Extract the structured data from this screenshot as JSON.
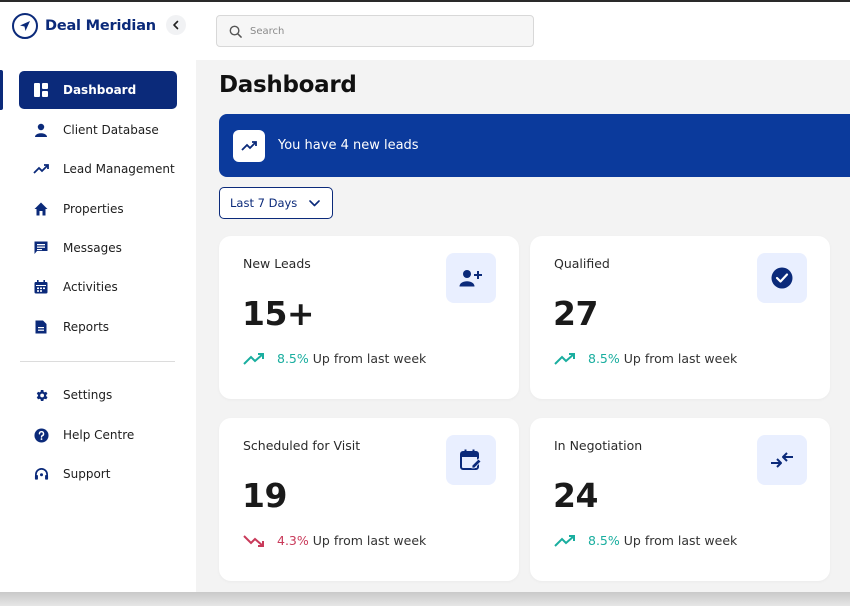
{
  "brand": {
    "name": "Deal Meridian"
  },
  "search": {
    "placeholder": "Search",
    "value": ""
  },
  "sidebar": {
    "items": [
      {
        "label": "Dashboard",
        "icon": "dashboard-icon",
        "active": true
      },
      {
        "label": "Client Database",
        "icon": "person-icon"
      },
      {
        "label": "Lead Management",
        "icon": "trend-up-icon"
      },
      {
        "label": "Properties",
        "icon": "home-icon"
      },
      {
        "label": "Messages",
        "icon": "message-icon"
      },
      {
        "label": "Activities",
        "icon": "calendar-icon"
      },
      {
        "label": "Reports",
        "icon": "document-icon"
      }
    ],
    "footer_items": [
      {
        "label": "Settings",
        "icon": "gear-icon"
      },
      {
        "label": "Help Centre",
        "icon": "help-icon"
      },
      {
        "label": "Support",
        "icon": "headset-icon"
      }
    ]
  },
  "main": {
    "title": "Dashboard",
    "banner": {
      "text": "You have 4 new leads",
      "icon": "trend-up-icon"
    },
    "range": {
      "selected": "Last 7 Days"
    },
    "cards": [
      {
        "label": "New Leads",
        "value": "15+",
        "icon": "add-person-icon",
        "trend": "up",
        "pct": "8.5%",
        "trend_text": "Up from last week"
      },
      {
        "label": "Qualified",
        "value": "27",
        "icon": "check-circle-icon",
        "trend": "up",
        "pct": "8.5%",
        "trend_text": "Up from last week"
      },
      {
        "label": "Scheduled for Visit",
        "value": "19",
        "icon": "calendar-edit-icon",
        "trend": "down",
        "pct": "4.3%",
        "trend_text": "Up from last week"
      },
      {
        "label": "In Negotiation",
        "value": "24",
        "icon": "arrows-converge-icon",
        "trend": "up",
        "pct": "8.5%",
        "trend_text": "Up from last week"
      }
    ]
  },
  "colors": {
    "brand": "#0b2a7a",
    "banner": "#0b3a9c",
    "up": "#1aae9f",
    "down": "#c93a5a",
    "icon_bg": "#e9efff"
  }
}
